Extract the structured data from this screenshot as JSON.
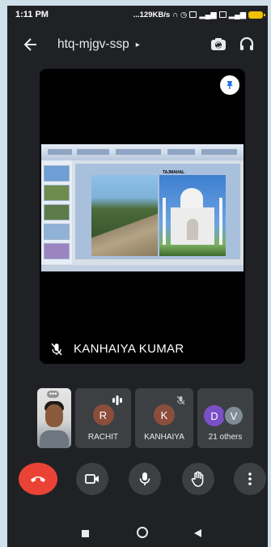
{
  "status_bar": {
    "time": "1:11 PM",
    "network_speed": "...129KB/s",
    "battery": "43"
  },
  "app_bar": {
    "meeting_code": "htq-mjgv-ssp",
    "caret": "▸"
  },
  "stage": {
    "speaker_name": "KANHAIYA KUMAR",
    "speaker_muted": true,
    "shared_slide_label": "TAJMAHAL"
  },
  "participants": {
    "self_more": "•••",
    "items": [
      {
        "initial": "R",
        "name": "RACHIT",
        "avatar_color": "#8b4e3c",
        "speaking": true
      },
      {
        "initial": "K",
        "name": "KANHAIYA",
        "avatar_color": "#8b4e3c",
        "muted": true
      }
    ],
    "others": {
      "initials": [
        "D",
        "V"
      ],
      "colors": [
        "#7b4fc8",
        "#7d8c96"
      ],
      "label": "21 others"
    }
  },
  "controls": {
    "end_call": "end-call",
    "camera": "camera",
    "mic": "mic",
    "raise_hand": "raise-hand",
    "more": "more"
  },
  "colors": {
    "background": "#202124",
    "tile": "#3c4043",
    "end_call": "#ea4335",
    "text": "#e8eaed"
  }
}
